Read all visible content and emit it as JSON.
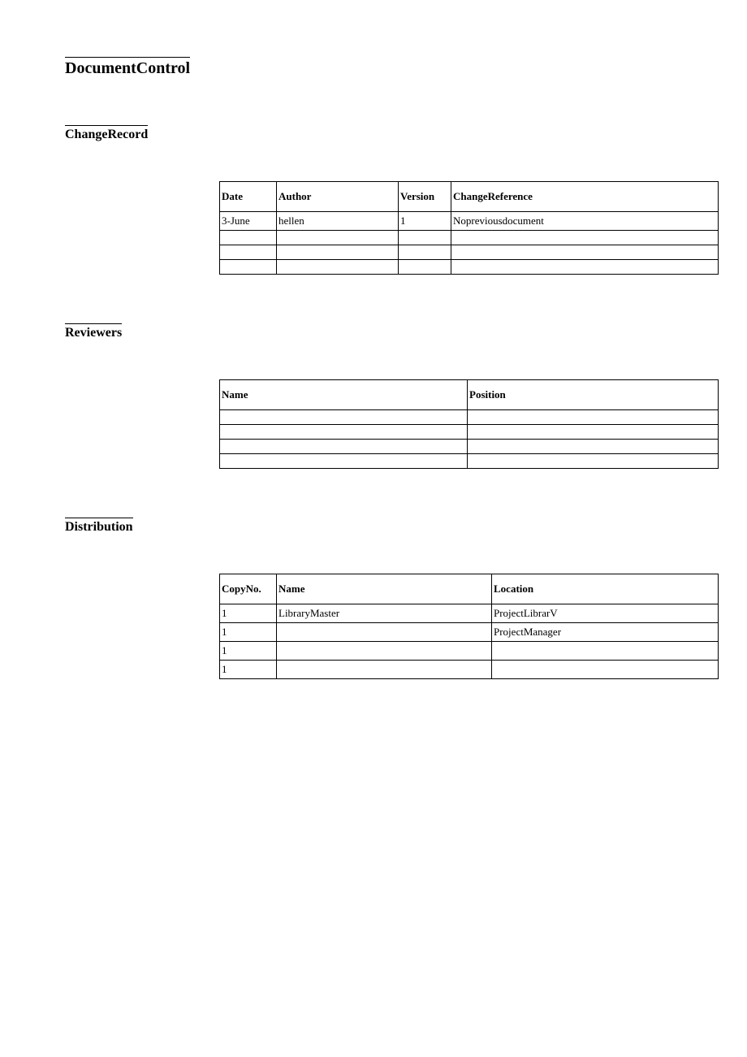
{
  "headings": {
    "document_control": "DocumentControl",
    "change_record": "ChangeRecord",
    "reviewers": "Reviewers",
    "distribution": "Distribution"
  },
  "change_record": {
    "headers": {
      "date": "Date",
      "author": "Author",
      "version": "Version",
      "change_reference": "ChangeReference"
    },
    "rows": [
      {
        "date": "3-June",
        "author": "hellen",
        "version": "1",
        "change_reference": "Nopreviousdocument"
      },
      {
        "date": "",
        "author": "",
        "version": "",
        "change_reference": ""
      },
      {
        "date": "",
        "author": "",
        "version": "",
        "change_reference": ""
      },
      {
        "date": "",
        "author": "",
        "version": "",
        "change_reference": ""
      }
    ]
  },
  "reviewers": {
    "headers": {
      "name": "Name",
      "position": "Position"
    },
    "rows": [
      {
        "name": "",
        "position": ""
      },
      {
        "name": "",
        "position": ""
      },
      {
        "name": "",
        "position": ""
      },
      {
        "name": "",
        "position": ""
      }
    ]
  },
  "distribution": {
    "headers": {
      "copy_no": "CopyNo.",
      "name": "Name",
      "location": "Location"
    },
    "rows": [
      {
        "copy_no": "1",
        "name": "LibraryMaster",
        "location": "ProjectLibrarV"
      },
      {
        "copy_no": "1",
        "name": "",
        "location": "ProjectManager"
      },
      {
        "copy_no": "1",
        "name": "",
        "location": ""
      },
      {
        "copy_no": "1",
        "name": "",
        "location": ""
      }
    ]
  }
}
